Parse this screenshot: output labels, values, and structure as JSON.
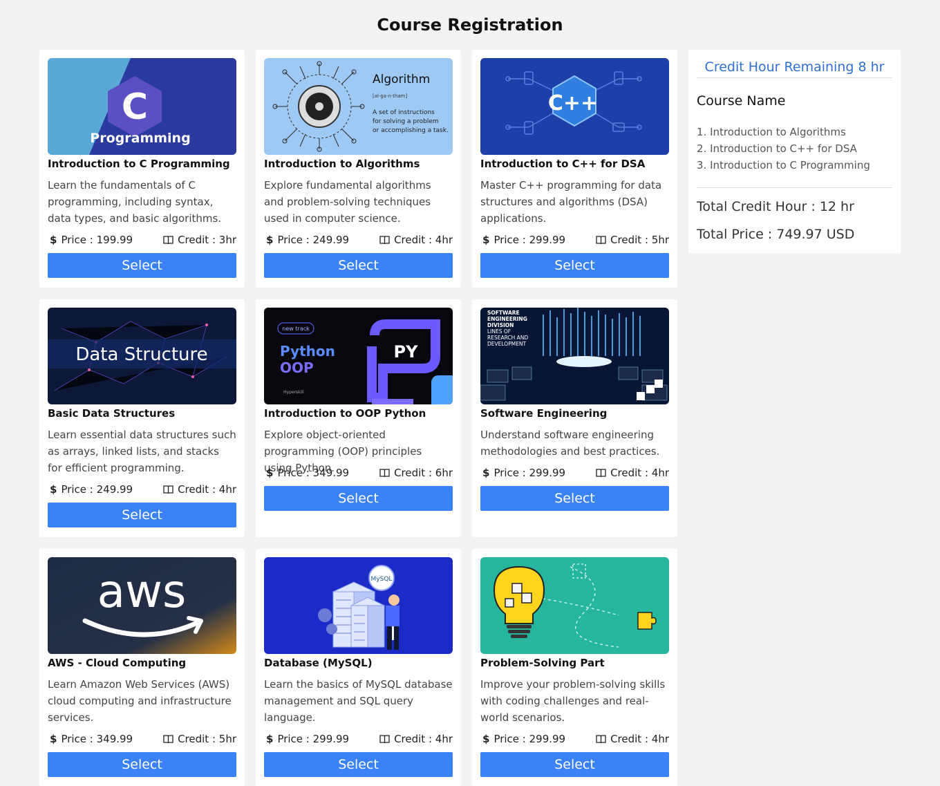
{
  "page": {
    "title": "Course Registration"
  },
  "courses": [
    {
      "title": "Introduction to C Programming",
      "description": "Learn the fundamentals of C programming, including syntax, data types, and basic algorithms.",
      "price_label": "Price : 199.99",
      "credit_label": "Credit : 3hr",
      "button": "Select",
      "image_text": "Programming",
      "image_glyph": "C",
      "image_icon": "c-programming-logo"
    },
    {
      "title": "Introduction to Algorithms",
      "description": "Explore fundamental algorithms and problem-solving techniques used in computer science.",
      "price_label": "Price : 249.99",
      "credit_label": "Credit : 4hr",
      "button": "Select",
      "image_text": "Algorithm",
      "image_sub": "[al·ga·ri·tham]",
      "image_lines": [
        "A set of instructions",
        "for solving a problem",
        "or accomplishing a task."
      ],
      "image_icon": "circuit-chip-illustration"
    },
    {
      "title": "Introduction to C++ for DSA",
      "description": "Master C++ programming for data structures and algorithms (DSA) applications.",
      "price_label": "Price : 299.99",
      "credit_label": "Credit : 5hr",
      "button": "Select",
      "image_glyph": "C++",
      "image_icon": "cpp-logo"
    },
    {
      "title": "Basic Data Structures",
      "description": "Learn essential data structures such as arrays, linked lists, and stacks for efficient programming.",
      "price_label": "Price : 249.99",
      "credit_label": "Credit : 4hr",
      "button": "Select",
      "image_text": "Data Structure",
      "image_icon": "network-graph-illustration"
    },
    {
      "title": "Introduction to OOP Python",
      "description": "Explore object-oriented programming (OOP) principles using Python.",
      "price_label": "Price : 349.99",
      "credit_label": "Credit : 6hr",
      "button": "Select",
      "image_badge": "new track",
      "image_text": "Python",
      "image_text2": "OOP",
      "image_glyph": "PY",
      "image_brand": "Hyperskill",
      "image_icon": "python-oop-banner"
    },
    {
      "title": "Software Engineering",
      "description": "Understand software engineering methodologies and best practices.",
      "price_label": "Price : 299.99",
      "credit_label": "Credit : 4hr",
      "button": "Select",
      "image_lines": [
        "SOFTWARE",
        "ENGINEERING",
        "DIVISION",
        "LINES OF",
        "RESEARCH AND",
        "DEVELOPMENT"
      ],
      "image_icon": "data-center-illustration"
    },
    {
      "title": "AWS - Cloud Computing",
      "description": "Learn Amazon Web Services (AWS) cloud computing and infrastructure services.",
      "price_label": "Price : 349.99",
      "credit_label": "Credit : 5hr",
      "button": "Select",
      "image_text": "aws",
      "image_icon": "aws-logo"
    },
    {
      "title": "Database (MySQL)",
      "description": "Learn the basics of MySQL database management and SQL query language.",
      "price_label": "Price : 299.99",
      "credit_label": "Credit : 4hr",
      "button": "Select",
      "image_text": "MySQL",
      "image_icon": "database-server-illustration"
    },
    {
      "title": "Problem-Solving Part",
      "description": "Improve your problem-solving skills with coding challenges and real-world scenarios.",
      "price_label": "Price : 299.99",
      "credit_label": "Credit : 4hr",
      "button": "Select",
      "image_icon": "lightbulb-puzzle-illustration"
    }
  ],
  "sidebar": {
    "remaining": "Credit Hour Remaining 8 hr",
    "heading": "Course Name",
    "selected": [
      "1. Introduction to Algorithms",
      "2. Introduction to C++ for DSA",
      "3. Introduction to C Programming"
    ],
    "total_credit": "Total Credit Hour : 12 hr",
    "total_price": "Total Price : 749.97 USD"
  },
  "icons": {
    "price": "$",
    "credit": "book-icon"
  },
  "colors": {
    "accent": "#3b82f6",
    "remaining_text": "#2f6fd6",
    "background": "#f3f3f3"
  }
}
